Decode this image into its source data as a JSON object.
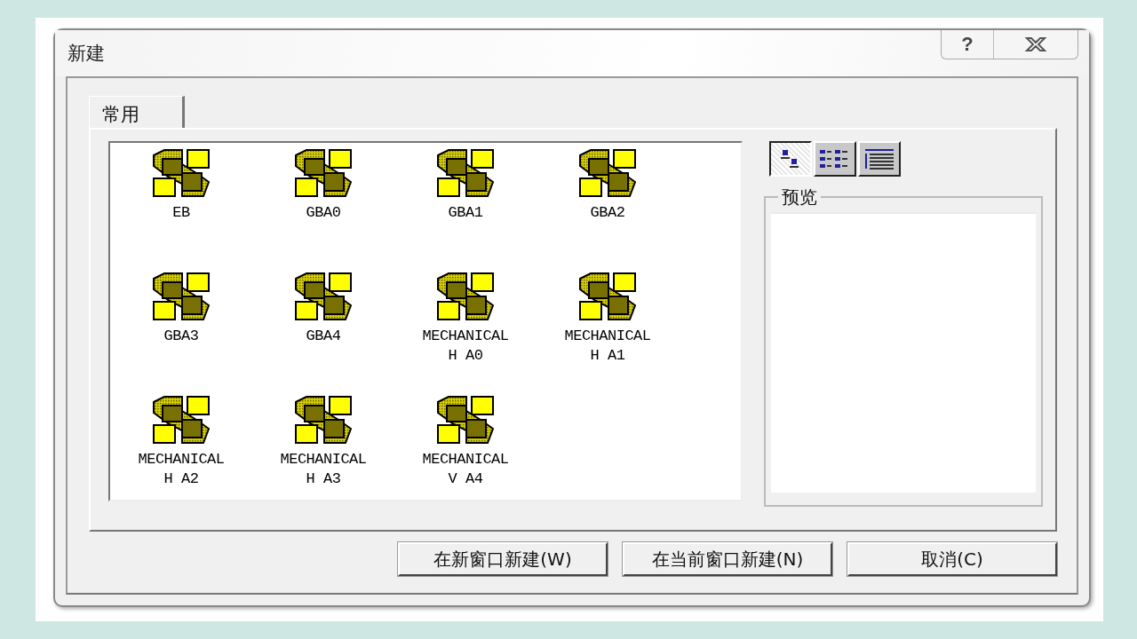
{
  "window": {
    "title": "新建",
    "help": "?"
  },
  "tabs": [
    {
      "label": "常用",
      "selected": true
    }
  ],
  "templates": [
    {
      "label": "EB"
    },
    {
      "label": "GBA0"
    },
    {
      "label": "GBA1"
    },
    {
      "label": "GBA2"
    },
    {
      "label": "GBA3"
    },
    {
      "label": "GBA4"
    },
    {
      "label": "MECHANICAL\nH A0"
    },
    {
      "label": "MECHANICAL\nH A1"
    },
    {
      "label": "MECHANICAL\nH A2"
    },
    {
      "label": "MECHANICAL\nH A3"
    },
    {
      "label": "MECHANICAL\nV A4"
    }
  ],
  "view_buttons": [
    {
      "kind": "large",
      "selected": true
    },
    {
      "kind": "list",
      "selected": false
    },
    {
      "kind": "details",
      "selected": false
    }
  ],
  "preview": {
    "title": "预览"
  },
  "buttons": [
    "在新窗口新建(W)",
    "在当前窗口新建(N)",
    "取消(C)"
  ]
}
